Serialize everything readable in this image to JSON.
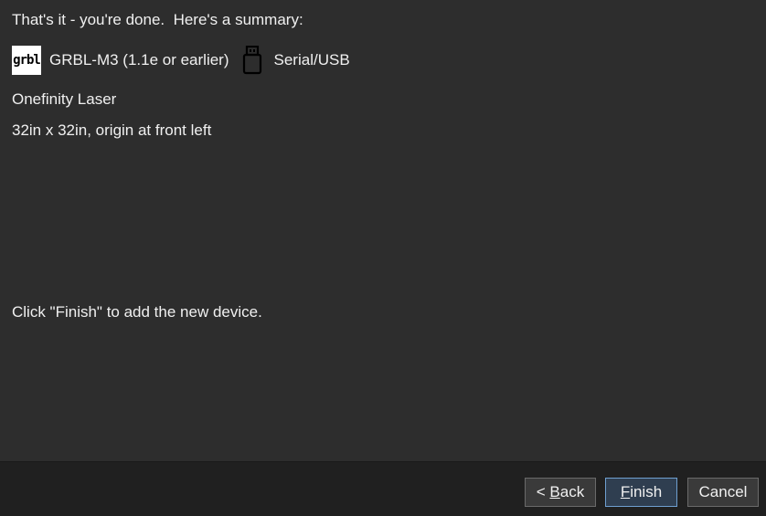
{
  "summary": {
    "title": "That's it - you're done.  Here's a summary:",
    "firmware_logo_text": "grbl",
    "firmware_label": "GRBL-M3 (1.1e or earlier)",
    "connection_icon": "usb-icon",
    "connection_label": "Serial/USB",
    "device_name": "Onefinity Laser",
    "bed_size": "32in x 32in, origin at front left",
    "finish_hint": "Click \"Finish\" to add the new device."
  },
  "buttons": {
    "back_prefix": "< ",
    "back_mnemonic": "B",
    "back_rest": "ack",
    "finish_mnemonic": "F",
    "finish_rest": "inish",
    "cancel_label": "Cancel"
  },
  "colors": {
    "background": "#2d2d2d",
    "footer": "#202020",
    "default_button_border": "#6f9fd0"
  }
}
